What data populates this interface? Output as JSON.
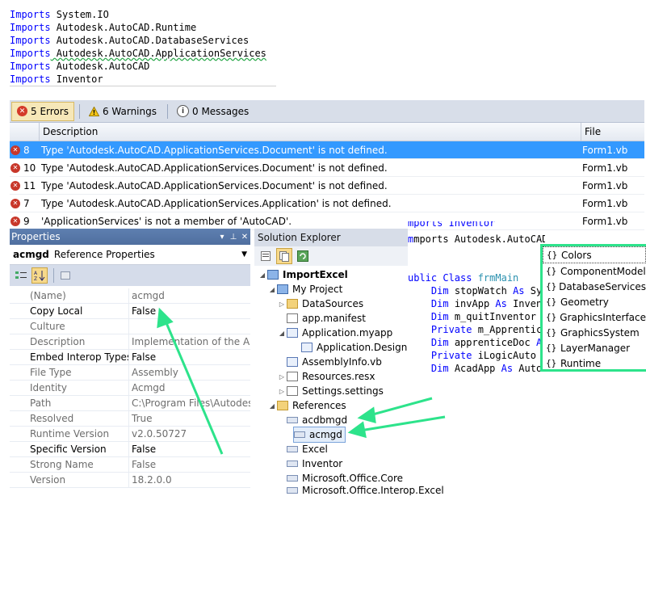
{
  "code_top": [
    {
      "kw": "Imports",
      "rest": " System.IO"
    },
    {
      "kw": "Imports",
      "rest": " Autodesk.AutoCAD.Runtime"
    },
    {
      "kw": "Imports",
      "rest": " Autodesk.AutoCAD.DatabaseServices"
    },
    {
      "kw": "Imports",
      "rest": " Autodesk.AutoCAD.ApplicationServices"
    },
    {
      "kw": "Imports",
      "rest": " Autodesk.AutoCAD"
    },
    {
      "kw": "Imports",
      "rest": " Inventor"
    }
  ],
  "error_list": {
    "tabs": {
      "errors": "5 Errors",
      "warnings": "6 Warnings",
      "messages": "0 Messages"
    },
    "columns": {
      "description": "Description",
      "file": "File"
    },
    "rows": [
      {
        "num": "8",
        "desc": "Type 'Autodesk.AutoCAD.ApplicationServices.Document' is not defined.",
        "file": "Form1.vb"
      },
      {
        "num": "10",
        "desc": "Type 'Autodesk.AutoCAD.ApplicationServices.Document' is not defined.",
        "file": "Form1.vb"
      },
      {
        "num": "11",
        "desc": "Type 'Autodesk.AutoCAD.ApplicationServices.Document' is not defined.",
        "file": "Form1.vb"
      },
      {
        "num": "7",
        "desc": "Type 'Autodesk.AutoCAD.ApplicationServices.Application' is not defined.",
        "file": "Form1.vb"
      },
      {
        "num": "9",
        "desc": "'ApplicationServices' is not a member of 'AutoCAD'.",
        "file": "Form1.vb"
      }
    ]
  },
  "properties": {
    "title": "Properties",
    "object_name": "acmgd",
    "object_type": "Reference Properties",
    "rows": [
      {
        "k": "(Name)",
        "v": "acmgd"
      },
      {
        "k": "Copy Local",
        "v": "False"
      },
      {
        "k": "Culture",
        "v": ""
      },
      {
        "k": "Description",
        "v": "Implementation of the AutoC"
      },
      {
        "k": "Embed Interop Types",
        "v": "False"
      },
      {
        "k": "File Type",
        "v": "Assembly"
      },
      {
        "k": "Identity",
        "v": "Acmgd"
      },
      {
        "k": "Path",
        "v": "C:\\Program Files\\Autodesk\\A"
      },
      {
        "k": "Resolved",
        "v": "True"
      },
      {
        "k": "Runtime Version",
        "v": "v2.0.50727"
      },
      {
        "k": "Specific Version",
        "v": "False"
      },
      {
        "k": "Strong Name",
        "v": "False"
      },
      {
        "k": "Version",
        "v": "18.2.0.0"
      }
    ]
  },
  "solution": {
    "title": "Solution Explorer",
    "items": [
      "ImportExcel",
      "My Project",
      "DataSources",
      "app.manifest",
      "Application.myapp",
      "Application.Design",
      "AssemblyInfo.vb",
      "Resources.resx",
      "Settings.settings",
      "References",
      "acdbmgd",
      "acmgd",
      "Excel",
      "Inventor",
      "Microsoft.Office.Core",
      "Microsoft.Office.Interop.Excel"
    ]
  },
  "code_right": {
    "l0": "mports Inventor",
    "l1": "mports Autodesk.AutoCAD.",
    "l4a": "ublic Class ",
    "l4b": "frmMain",
    "l5": [
      "Dim",
      " stopWatch ",
      "As",
      " Syst"
    ],
    "l6": [
      "Dim",
      " invApp ",
      "As",
      " Invento"
    ],
    "l7": [
      "Dim",
      " m_quitInventor ",
      "As",
      ""
    ],
    "l8": [
      "Private",
      " m_Apprentice",
      "",
      ""
    ],
    "l9": [
      "Dim",
      " apprenticeDoc ",
      "As",
      ""
    ],
    "l10": [
      "Private",
      " iLogicAuto ",
      "As",
      ""
    ],
    "l11": [
      "Dim",
      " AcadApp ",
      "As",
      " Autode"
    ]
  },
  "intellisense": [
    "Colors",
    "ComponentModel",
    "DatabaseServices",
    "Geometry",
    "GraphicsInterface",
    "GraphicsSystem",
    "LayerManager",
    "Runtime"
  ],
  "colors": {
    "selection": "#3399ff",
    "arrow": "#2de38b",
    "keyword": "#0000ff"
  }
}
